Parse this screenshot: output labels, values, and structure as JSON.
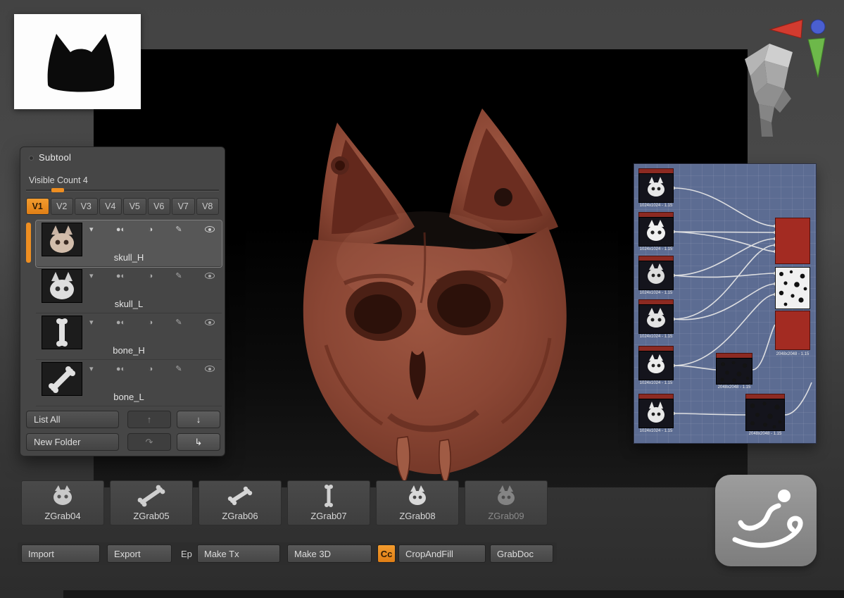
{
  "colors": {
    "accent": "#ee8e21",
    "node_red": "#a32b22",
    "node_panel": "#5c6c92"
  },
  "icons": {
    "collapse": "▾",
    "toggle_pair": "●◐",
    "half_toggle": "◑",
    "paint": "✎",
    "up_arrow": "↑",
    "down_arrow": "↓",
    "duplicate_arrow": "↷",
    "append_arrow": "↳"
  },
  "subtool": {
    "title": "Subtool",
    "visible_count_label": "Visible Count 4",
    "active_tab": "V1",
    "tabs": [
      {
        "label": "V1"
      },
      {
        "label": "V2"
      },
      {
        "label": "V3"
      },
      {
        "label": "V4"
      },
      {
        "label": "V5"
      },
      {
        "label": "V6"
      },
      {
        "label": "V7"
      },
      {
        "label": "V8"
      }
    ],
    "items": [
      {
        "label": "skull_H"
      },
      {
        "label": "skull_L"
      },
      {
        "label": "bone_H"
      },
      {
        "label": "bone_L"
      }
    ],
    "buttons": {
      "list_all": "List All",
      "new_folder": "New Folder"
    }
  },
  "node_editor": {
    "source_captions": [
      "1024x1024 - 1.15",
      "1024x1024 - 1.15",
      "1024x1024 - 1.15",
      "1024x1024 - 1.15",
      "1024x1024 - 1.15",
      "1024x1024 - 1.15"
    ],
    "output_caption": "2048x2048 - 1.15",
    "mid_caption": "2048x2048 - 1.15",
    "bottom_caption": "2048x2048 - 1.15"
  },
  "grab_strip": [
    {
      "label": "ZGrab04"
    },
    {
      "label": "ZGrab05"
    },
    {
      "label": "ZGrab06"
    },
    {
      "label": "ZGrab07"
    },
    {
      "label": "ZGrab08"
    },
    {
      "label": "ZGrab09"
    }
  ],
  "toolbar": {
    "import": "Import",
    "export": "Export",
    "ep": "Ep",
    "make_tx": "Make Tx",
    "make_3d": "Make 3D",
    "cc": "Cc",
    "crop_and_fill": "CropAndFill",
    "grab_doc": "GrabDoc"
  }
}
